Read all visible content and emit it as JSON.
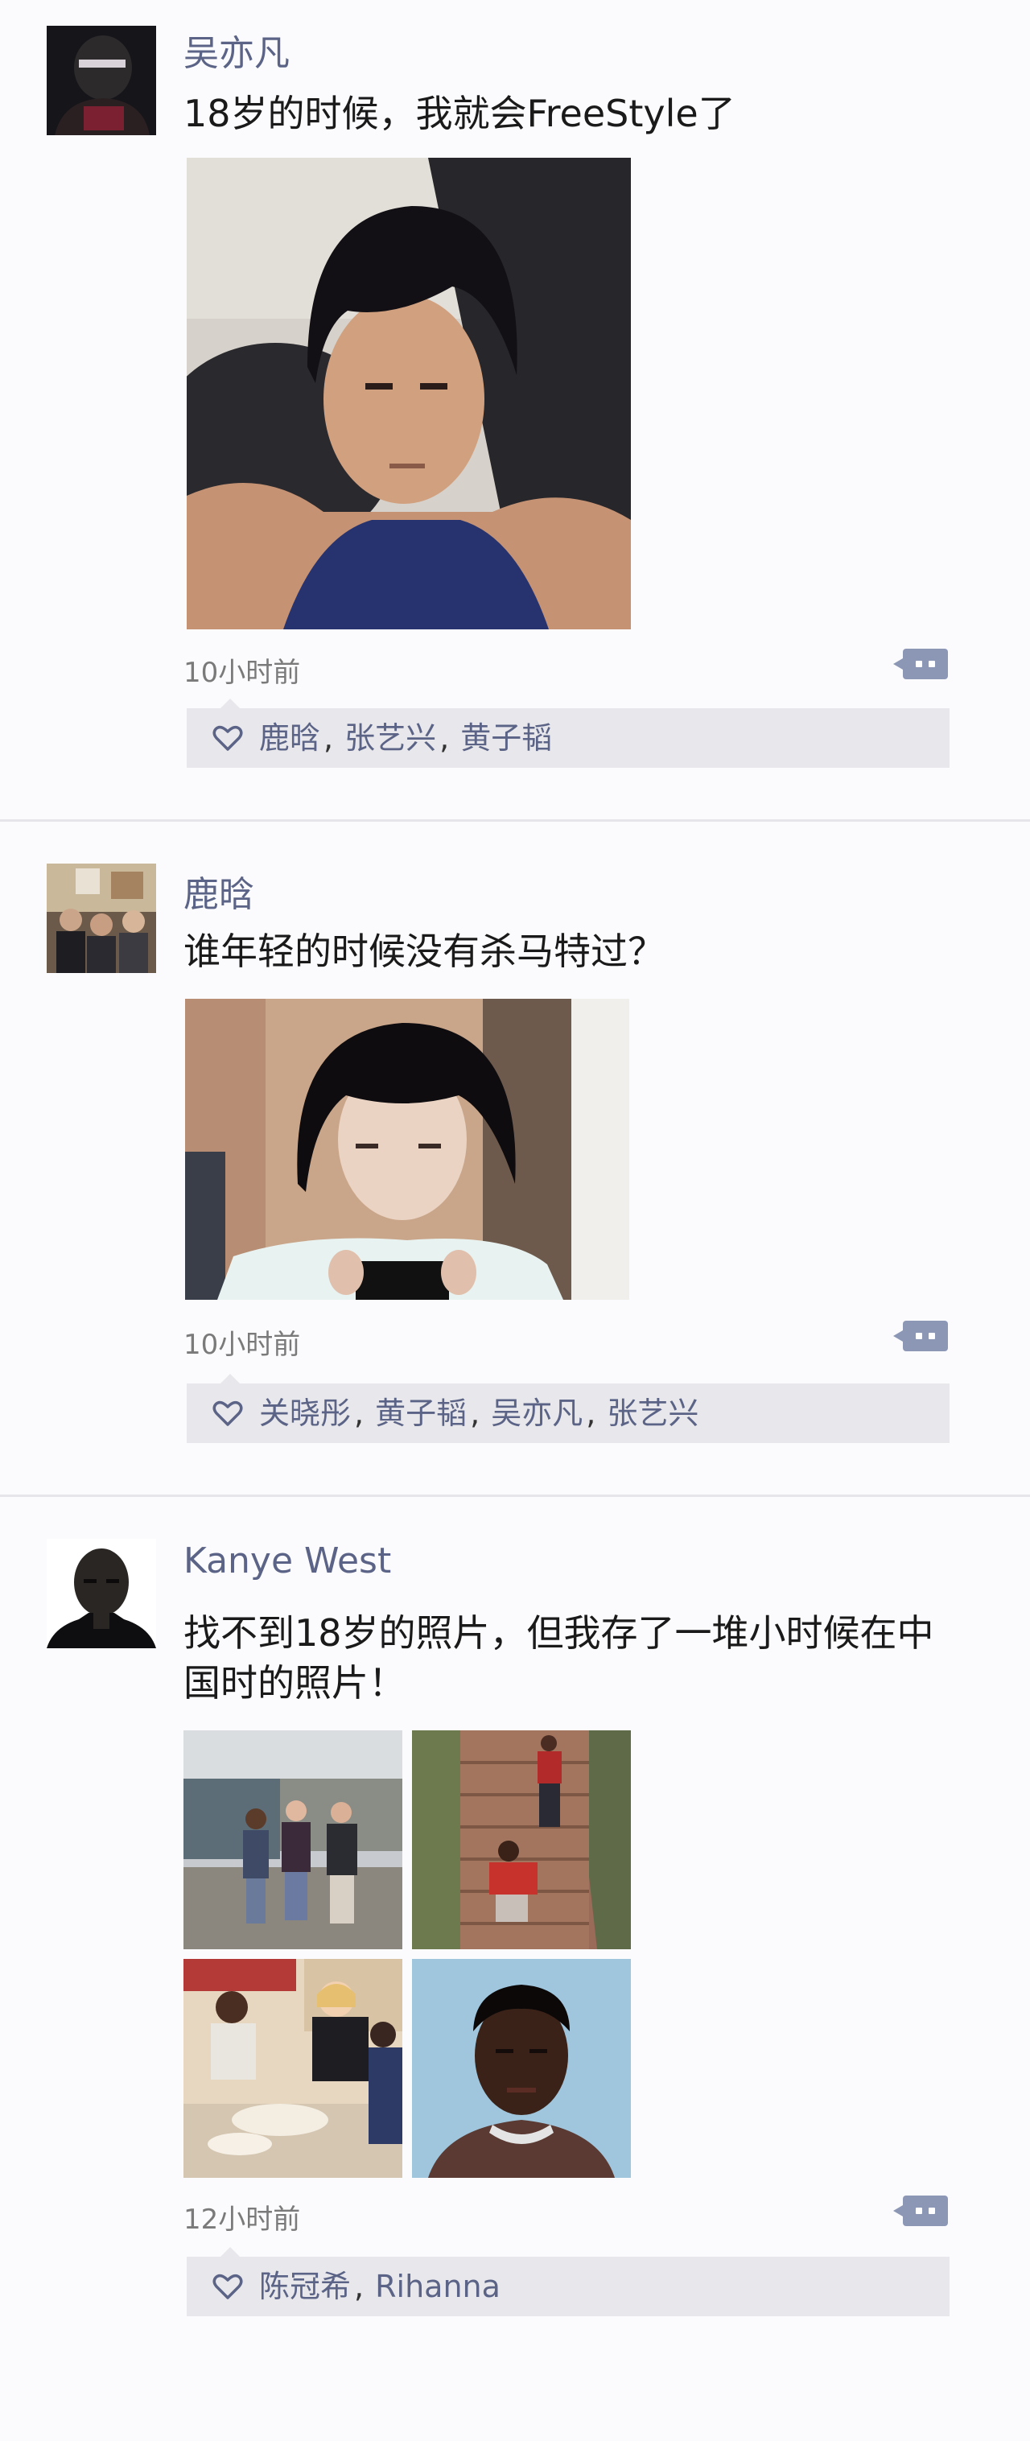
{
  "posts": [
    {
      "username": "吴亦凡",
      "text": "18岁的时候，我就会FreeStyle了",
      "time": "10小时前",
      "likes": [
        "鹿晗",
        "张艺兴",
        "黄子韬"
      ]
    },
    {
      "username": "鹿晗",
      "text": "谁年轻的时候没有杀马特过？",
      "time": "10小时前",
      "likes": [
        "关晓彤",
        "黄子韬",
        "吴亦凡",
        "张艺兴"
      ]
    },
    {
      "username": "Kanye West",
      "text": "找不到18岁的照片，但我存了一堆小时候在中国时的照片！",
      "time": "12小时前",
      "likes": [
        "陈冠希",
        "Rihanna"
      ]
    }
  ],
  "ui": {
    "like_icon": "heart-outline-icon",
    "comment_icon": "comment-bubble-icon",
    "accent_color": "#5b6486",
    "separator": ","
  }
}
